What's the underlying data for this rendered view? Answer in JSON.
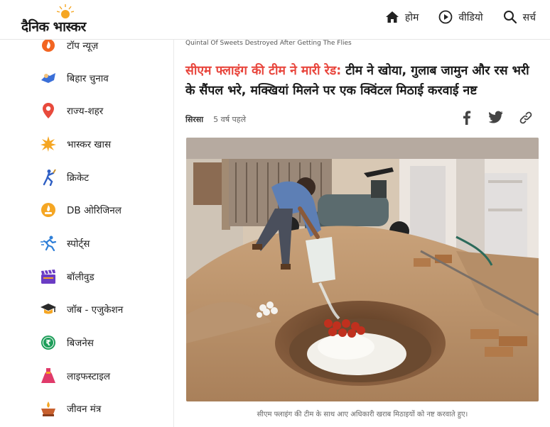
{
  "header": {
    "logo_text": "दैनिक भास्कर",
    "nav": [
      {
        "label": "होम",
        "icon": "home-icon"
      },
      {
        "label": "वीडियो",
        "icon": "play-icon"
      },
      {
        "label": "सर्च",
        "icon": "search-icon"
      }
    ]
  },
  "sidebar": {
    "items": [
      {
        "label": "टॉप न्यूज़",
        "icon": "top-news-icon"
      },
      {
        "label": "बिहार चुनाव",
        "icon": "election-icon"
      },
      {
        "label": "राज्य-शहर",
        "icon": "location-pin-icon"
      },
      {
        "label": "भास्कर खास",
        "icon": "sun-icon"
      },
      {
        "label": "क्रिकेट",
        "icon": "cricket-icon"
      },
      {
        "label": "DB ओरिजिनल",
        "icon": "db-original-icon"
      },
      {
        "label": "स्पोर्ट्स",
        "icon": "running-icon"
      },
      {
        "label": "बॉलीवुड",
        "icon": "clapperboard-icon"
      },
      {
        "label": "जॉब - एजुकेशन",
        "icon": "graduation-cap-icon"
      },
      {
        "label": "बिजनेस",
        "icon": "rupee-icon"
      },
      {
        "label": "लाइफस्टाइल",
        "icon": "dress-icon"
      },
      {
        "label": "जीवन मंत्र",
        "icon": "diya-icon"
      }
    ]
  },
  "article": {
    "english_title": "Quintal Of Sweets Destroyed After Getting The Flies",
    "headline_highlight": "सीएम फ्लाइंग की टीम ने मारी रेड:",
    "headline_rest": " टीम ने खोया, गुलाब जामुन और रस भरी के सैंपल भरे, मक्खियां मिलने पर एक क्विंटल मिठाई करवाई नष्ट",
    "city": "सिरसा",
    "time_ago": "5 वर्ष पहले",
    "share_icons": [
      "facebook-icon",
      "twitter-icon",
      "link-icon"
    ],
    "caption": "सीएम फ्लाइंग की टीम के साथ आए अधिकारी खराब मिठाइयों को नष्ट करवाते हुए।"
  },
  "colors": {
    "headline_accent": "#e8453c",
    "logo_sun": "#f5a623"
  }
}
